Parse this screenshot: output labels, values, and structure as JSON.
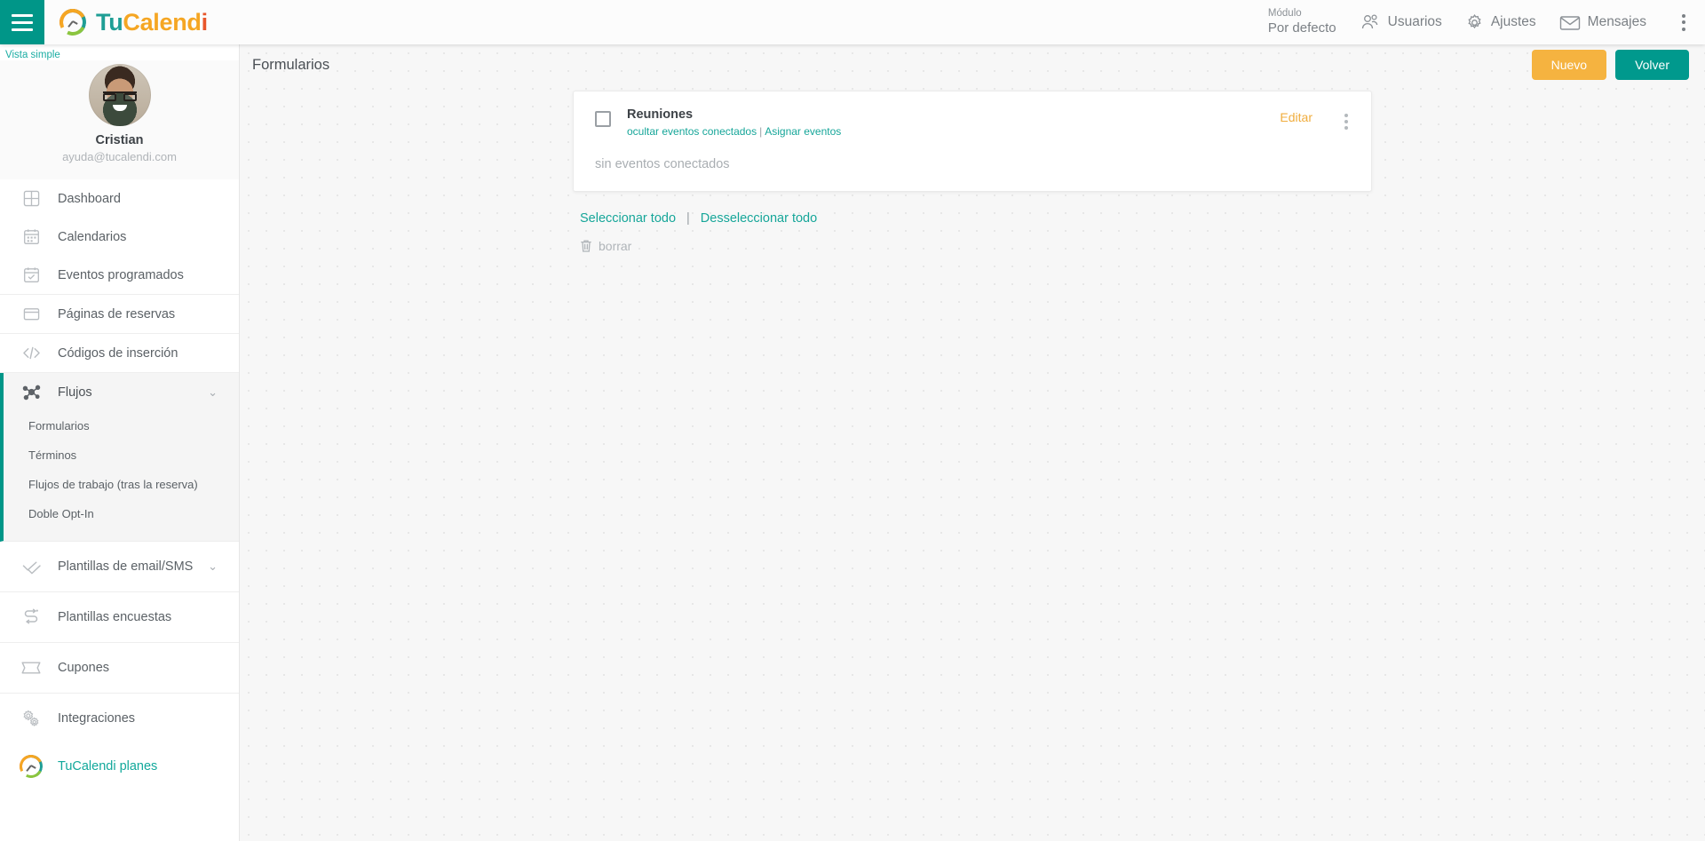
{
  "topbar": {
    "hamburger": "menu-icon",
    "brand": {
      "part1": "Tu",
      "part2": "Calend",
      "part3": "i"
    },
    "modulo_label": "Módulo",
    "modulo_value": "Por defecto",
    "items": [
      {
        "label": "Usuarios",
        "icon": "users-icon"
      },
      {
        "label": "Ajustes",
        "icon": "gear-icon"
      },
      {
        "label": "Mensajes",
        "icon": "envelope-icon"
      }
    ],
    "kebab": "vertical-dots-icon"
  },
  "sidebar": {
    "vista_simple": "Vista simple",
    "profile": {
      "name": "Cristian",
      "email": "ayuda@tucalendi.com"
    },
    "items": [
      {
        "label": "Dashboard",
        "icon": "grid-icon"
      },
      {
        "label": "Calendarios",
        "icon": "calendar-icon"
      },
      {
        "label": "Eventos programados",
        "icon": "calendar-check-icon"
      },
      {
        "label": "Páginas de reservas",
        "icon": "window-icon"
      },
      {
        "label": "Códigos de inserción",
        "icon": "code-icon"
      },
      {
        "label": "Flujos",
        "icon": "nodes-icon",
        "expanded": true,
        "chevron": "⌄"
      },
      {
        "label": "Plantillas de email/SMS",
        "icon": "double-check-icon",
        "chevron": "⌄"
      },
      {
        "label": "Plantillas encuestas",
        "icon": "survey-icon"
      },
      {
        "label": "Cupones",
        "icon": "ticket-icon"
      },
      {
        "label": "Integraciones",
        "icon": "gears-icon"
      },
      {
        "label": "TuCalendi planes",
        "icon": "tucalendi-logo-icon"
      }
    ],
    "flujos_submenu": [
      {
        "label": "Formularios"
      },
      {
        "label": "Términos"
      },
      {
        "label": "Flujos de trabajo (tras la reserva)"
      },
      {
        "label": "Doble Opt-In"
      }
    ]
  },
  "page": {
    "title": "Formularios",
    "btn_new": "Nuevo",
    "btn_back": "Volver"
  },
  "form_card": {
    "title": "Reuniones",
    "link_hide_events": "ocultar eventos conectados",
    "link_separator": "|",
    "link_assign_events": "Asignar eventos",
    "edit_label": "Editar",
    "empty_text": "sin eventos conectados",
    "kebab": "vertical-dots-icon",
    "checkbox": "unchecked"
  },
  "bulk": {
    "select_all": "Seleccionar todo",
    "separator": "|",
    "deselect_all": "Desseleccionar todo",
    "delete_label": "borrar",
    "delete_icon": "trash-icon"
  },
  "colors": {
    "teal": "#009688",
    "teal_link": "#16a699",
    "orange": "#f5b340",
    "edit_orange": "#f0ad3e",
    "muted": "#a9aeb2"
  }
}
